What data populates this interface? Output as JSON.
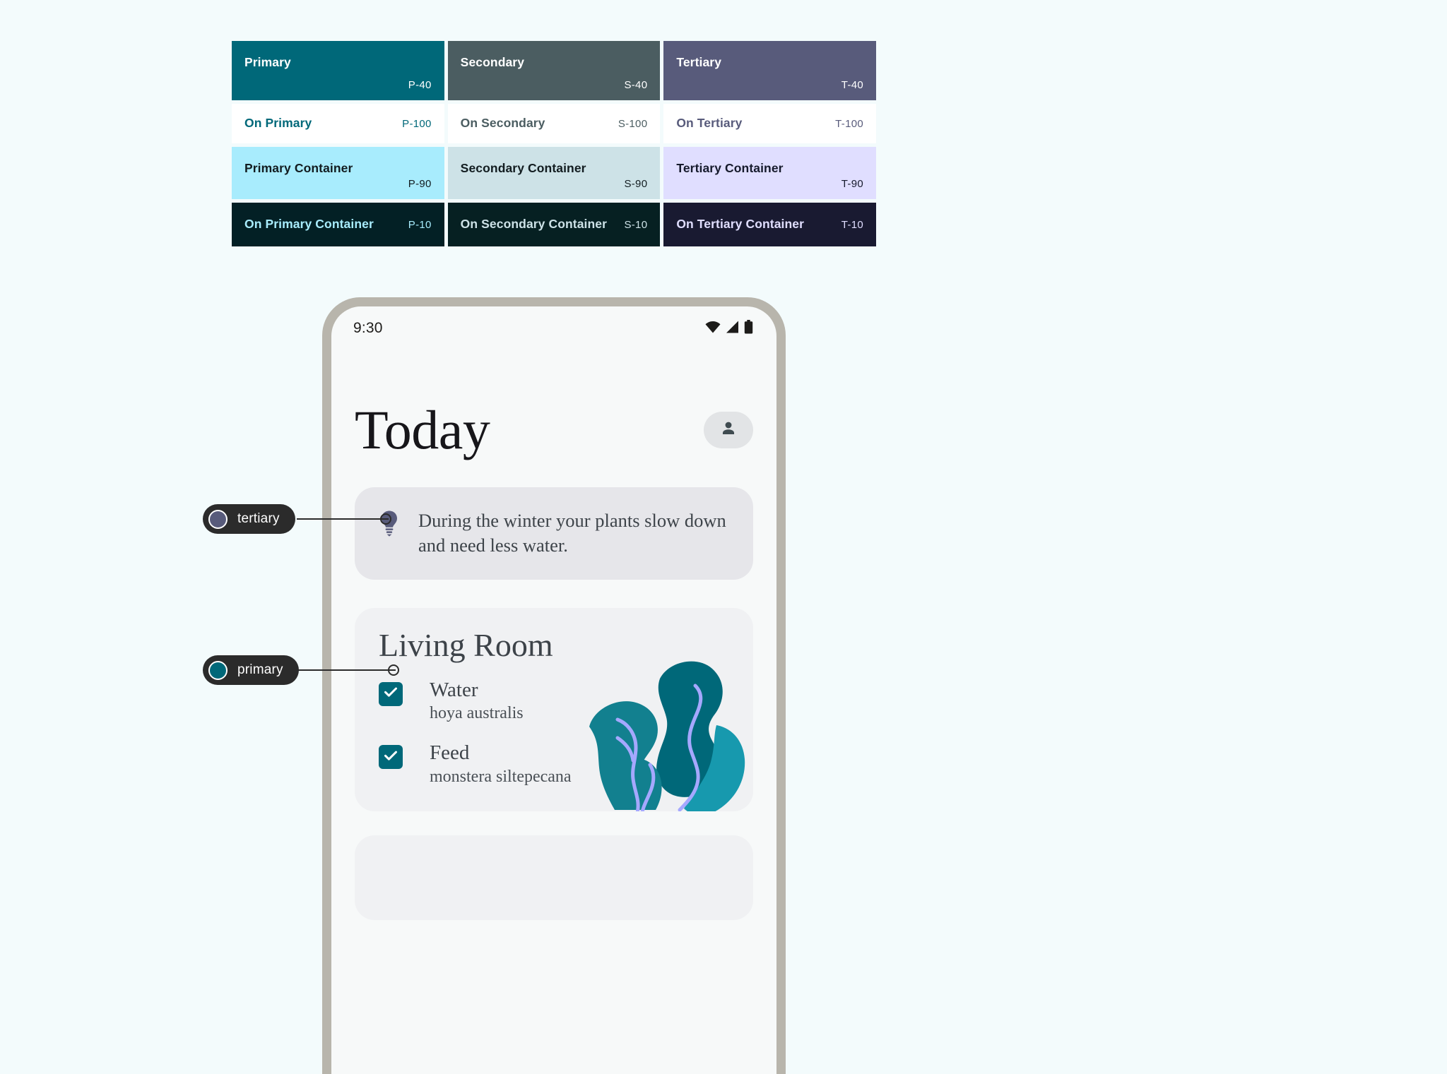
{
  "palette": {
    "columns": [
      {
        "key": "primary",
        "swatches": [
          {
            "name": "Primary",
            "token": "P-40",
            "bg": "#006879",
            "fg": "#ffffff"
          },
          {
            "name": "On Primary",
            "token": "P-100",
            "bg": "#ffffff",
            "fg": "#006879"
          },
          {
            "name": "Primary Container",
            "token": "P-90",
            "bg": "#a8ecfd",
            "fg": "#121c20"
          },
          {
            "name": "On Primary Container",
            "token": "P-10",
            "bg": "#032025",
            "fg": "#a8ecfd"
          }
        ]
      },
      {
        "key": "secondary",
        "swatches": [
          {
            "name": "Secondary",
            "token": "S-40",
            "bg": "#4b5d61",
            "fg": "#ffffff"
          },
          {
            "name": "On Secondary",
            "token": "S-100",
            "bg": "#ffffff",
            "fg": "#4b5d61"
          },
          {
            "name": "Secondary Container",
            "token": "S-90",
            "bg": "#cde2e7",
            "fg": "#121c20"
          },
          {
            "name": "On Secondary Container",
            "token": "S-10",
            "bg": "#062022",
            "fg": "#cde2e7"
          }
        ]
      },
      {
        "key": "tertiary",
        "swatches": [
          {
            "name": "Tertiary",
            "token": "T-40",
            "bg": "#585b7b",
            "fg": "#ffffff"
          },
          {
            "name": "On Tertiary",
            "token": "T-100",
            "bg": "#ffffff",
            "fg": "#585b7b"
          },
          {
            "name": "Tertiary Container",
            "token": "T-90",
            "bg": "#e0deff",
            "fg": "#161a2c"
          },
          {
            "name": "On Tertiary Container",
            "token": "T-10",
            "bg": "#191a31",
            "fg": "#e0deff"
          }
        ]
      }
    ]
  },
  "callouts": [
    {
      "label": "tertiary",
      "dot_color": "#585b7b"
    },
    {
      "label": "primary",
      "dot_color": "#006879"
    }
  ],
  "phone": {
    "status_bar": {
      "time": "9:30",
      "icons": [
        "wifi-icon",
        "signal-icon",
        "battery-icon"
      ]
    },
    "header": {
      "title": "Today",
      "avatar_icon": "person-icon"
    },
    "tip_card": {
      "icon": "lightbulb-icon",
      "icon_color": "#585b7b",
      "text": "During the winter your plants slow down and need less water."
    },
    "room_card": {
      "title": "Living Room",
      "tasks": [
        {
          "label": "Water",
          "plant": "hoya australis",
          "checked": true
        },
        {
          "label": "Feed",
          "plant": "monstera siltepecana",
          "checked": true
        }
      ],
      "checkbox_color": "#006879",
      "illustration": "plant-illustration"
    }
  }
}
